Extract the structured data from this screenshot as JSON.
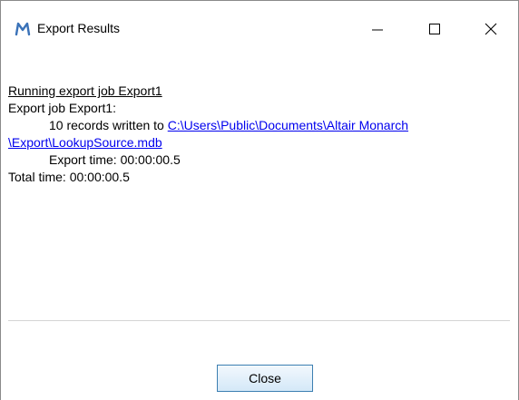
{
  "window": {
    "title": "Export Results",
    "app_icon": "monarch-m-icon",
    "controls": {
      "minimize": "minimize-icon",
      "maximize": "maximize-icon",
      "close": "close-icon"
    }
  },
  "log": {
    "heading": "Running export job Export1",
    "job_line": "Export job Export1:",
    "records_prefix": "10 records written to ",
    "path_part1": "C:\\Users\\Public\\Documents\\Altair Monarch",
    "path_part2": "\\Export\\LookupSource.mdb",
    "export_time": "Export time: 00:00:00.5",
    "total_time": "Total time: 00:00:00.5"
  },
  "footer": {
    "close_label": "Close"
  },
  "colors": {
    "link": "#0000ee",
    "icon_accent": "#2b6cb0",
    "button_border": "#3c7fb1"
  }
}
